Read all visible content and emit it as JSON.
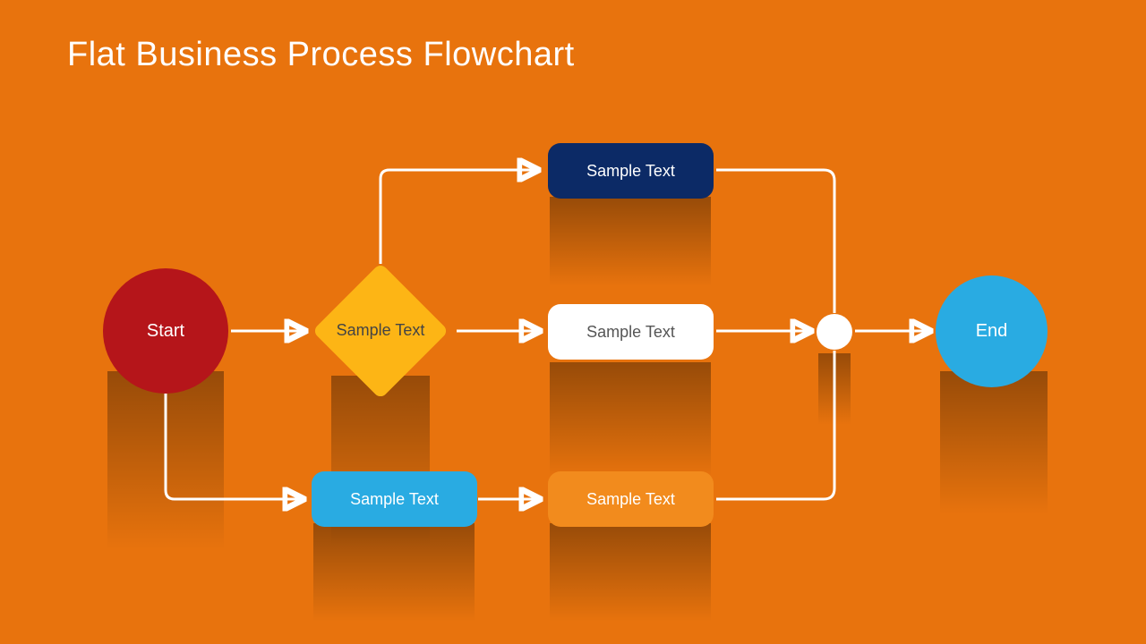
{
  "title": "Flat Business Process Flowchart",
  "nodes": {
    "start": {
      "label": "Start",
      "color": "#b5151a",
      "text": "#ffffff"
    },
    "decision": {
      "label": "Sample Text",
      "color": "#fdb515",
      "text": "#444444"
    },
    "top": {
      "label": "Sample Text",
      "color": "#0c2a66",
      "text": "#ffffff"
    },
    "mid": {
      "label": "Sample Text",
      "color": "#ffffff",
      "text": "#555555"
    },
    "bottomRight": {
      "label": "Sample Text",
      "color": "#f28b1d",
      "text": "#ffffff"
    },
    "bottomLeft": {
      "label": "Sample Text",
      "color": "#29abe2",
      "text": "#ffffff"
    },
    "junction": {
      "color": "#ffffff"
    },
    "end": {
      "label": "End",
      "color": "#29abe2",
      "text": "#ffffff"
    }
  }
}
